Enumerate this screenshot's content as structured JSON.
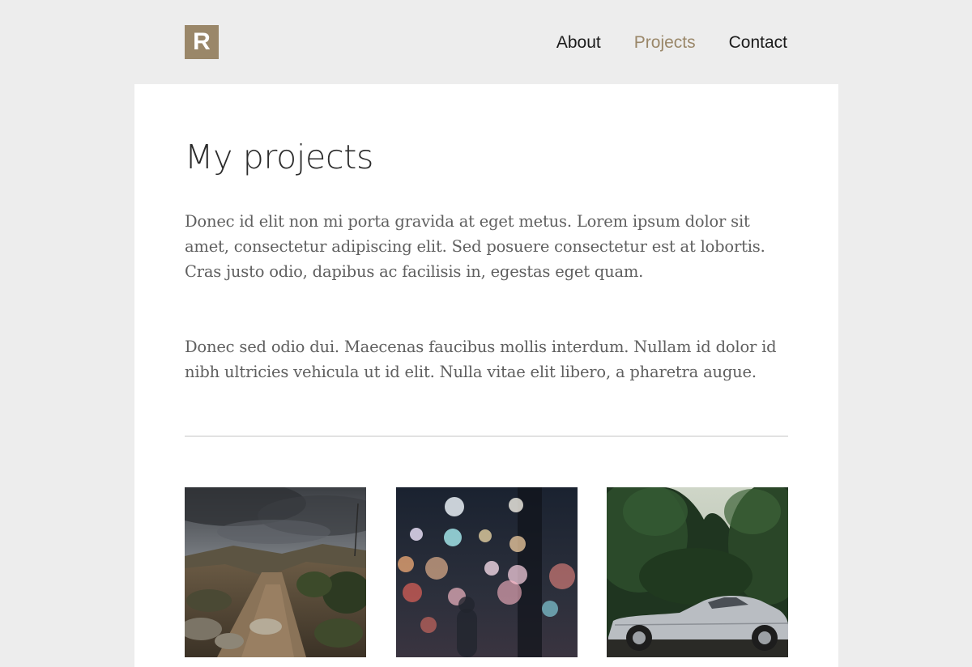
{
  "header": {
    "logo_letter": "R",
    "nav": {
      "about": "About",
      "projects": "Projects",
      "contact": "Contact",
      "active": "projects"
    }
  },
  "main": {
    "title": "My projects",
    "paragraphs": [
      "Donec id elit non mi porta gravida at eget metus. Lorem ipsum dolor sit amet, consectetur adipiscing elit. Sed posuere consectetur est at lobortis. Cras justo odio, dapibus ac facilisis in, egestas eget quam.",
      "Donec sed odio dui. Maecenas faucibus mollis interdum. Nullam id dolor id nibh ultricies vehicula ut id elit. Nulla vitae elit libero, a pharetra augue."
    ],
    "projects": [
      {
        "image": "stormy-dirt-road-photo"
      },
      {
        "image": "city-bokeh-lights-photo"
      },
      {
        "image": "silver-vintage-car-forest-photo"
      }
    ]
  },
  "colors": {
    "accent": "#9a8769",
    "background": "#ededed",
    "card": "#ffffff",
    "body_text": "#5f5f5f",
    "nav_text": "#1b1b1b"
  }
}
